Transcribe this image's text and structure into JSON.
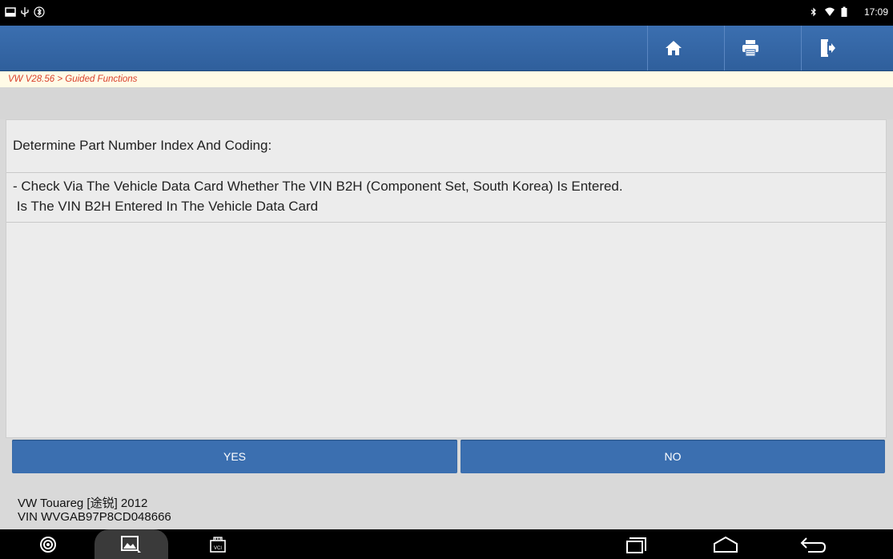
{
  "status_bar": {
    "time": "17:09",
    "left_icons": [
      "screenshot-icon",
      "usb-icon",
      "bluetooth-icon"
    ],
    "right_icons": [
      "bluetooth-icon",
      "wifi-icon",
      "battery-icon"
    ]
  },
  "toolbar": {
    "icons": [
      "home-icon",
      "print-icon",
      "exit-icon"
    ]
  },
  "breadcrumb": "VW V28.56 > Guided Functions",
  "content": {
    "title": "Determine Part Number Index And Coding:",
    "description_line1": "- Check Via The Vehicle Data Card Whether The VIN B2H (Component Set, South Korea) Is Entered.",
    "description_line2": " Is The VIN B2H Entered In The Vehicle Data Card"
  },
  "buttons": {
    "yes": "YES",
    "no": "NO"
  },
  "footer": {
    "vehicle": "VW Touareg [途锐] 2012",
    "vin": "VIN WVGAB97P8CD048666"
  },
  "nav_bar": {
    "vci_label": "VCI",
    "icons": [
      "app-icon",
      "gallery-icon",
      "vci-icon",
      "recent-apps-icon",
      "home-nav-icon",
      "back-icon"
    ]
  },
  "colors": {
    "toolbar": "#3b6fb0",
    "breadcrumb_text": "#d9402b",
    "breadcrumb_bg": "#fffbe6"
  }
}
